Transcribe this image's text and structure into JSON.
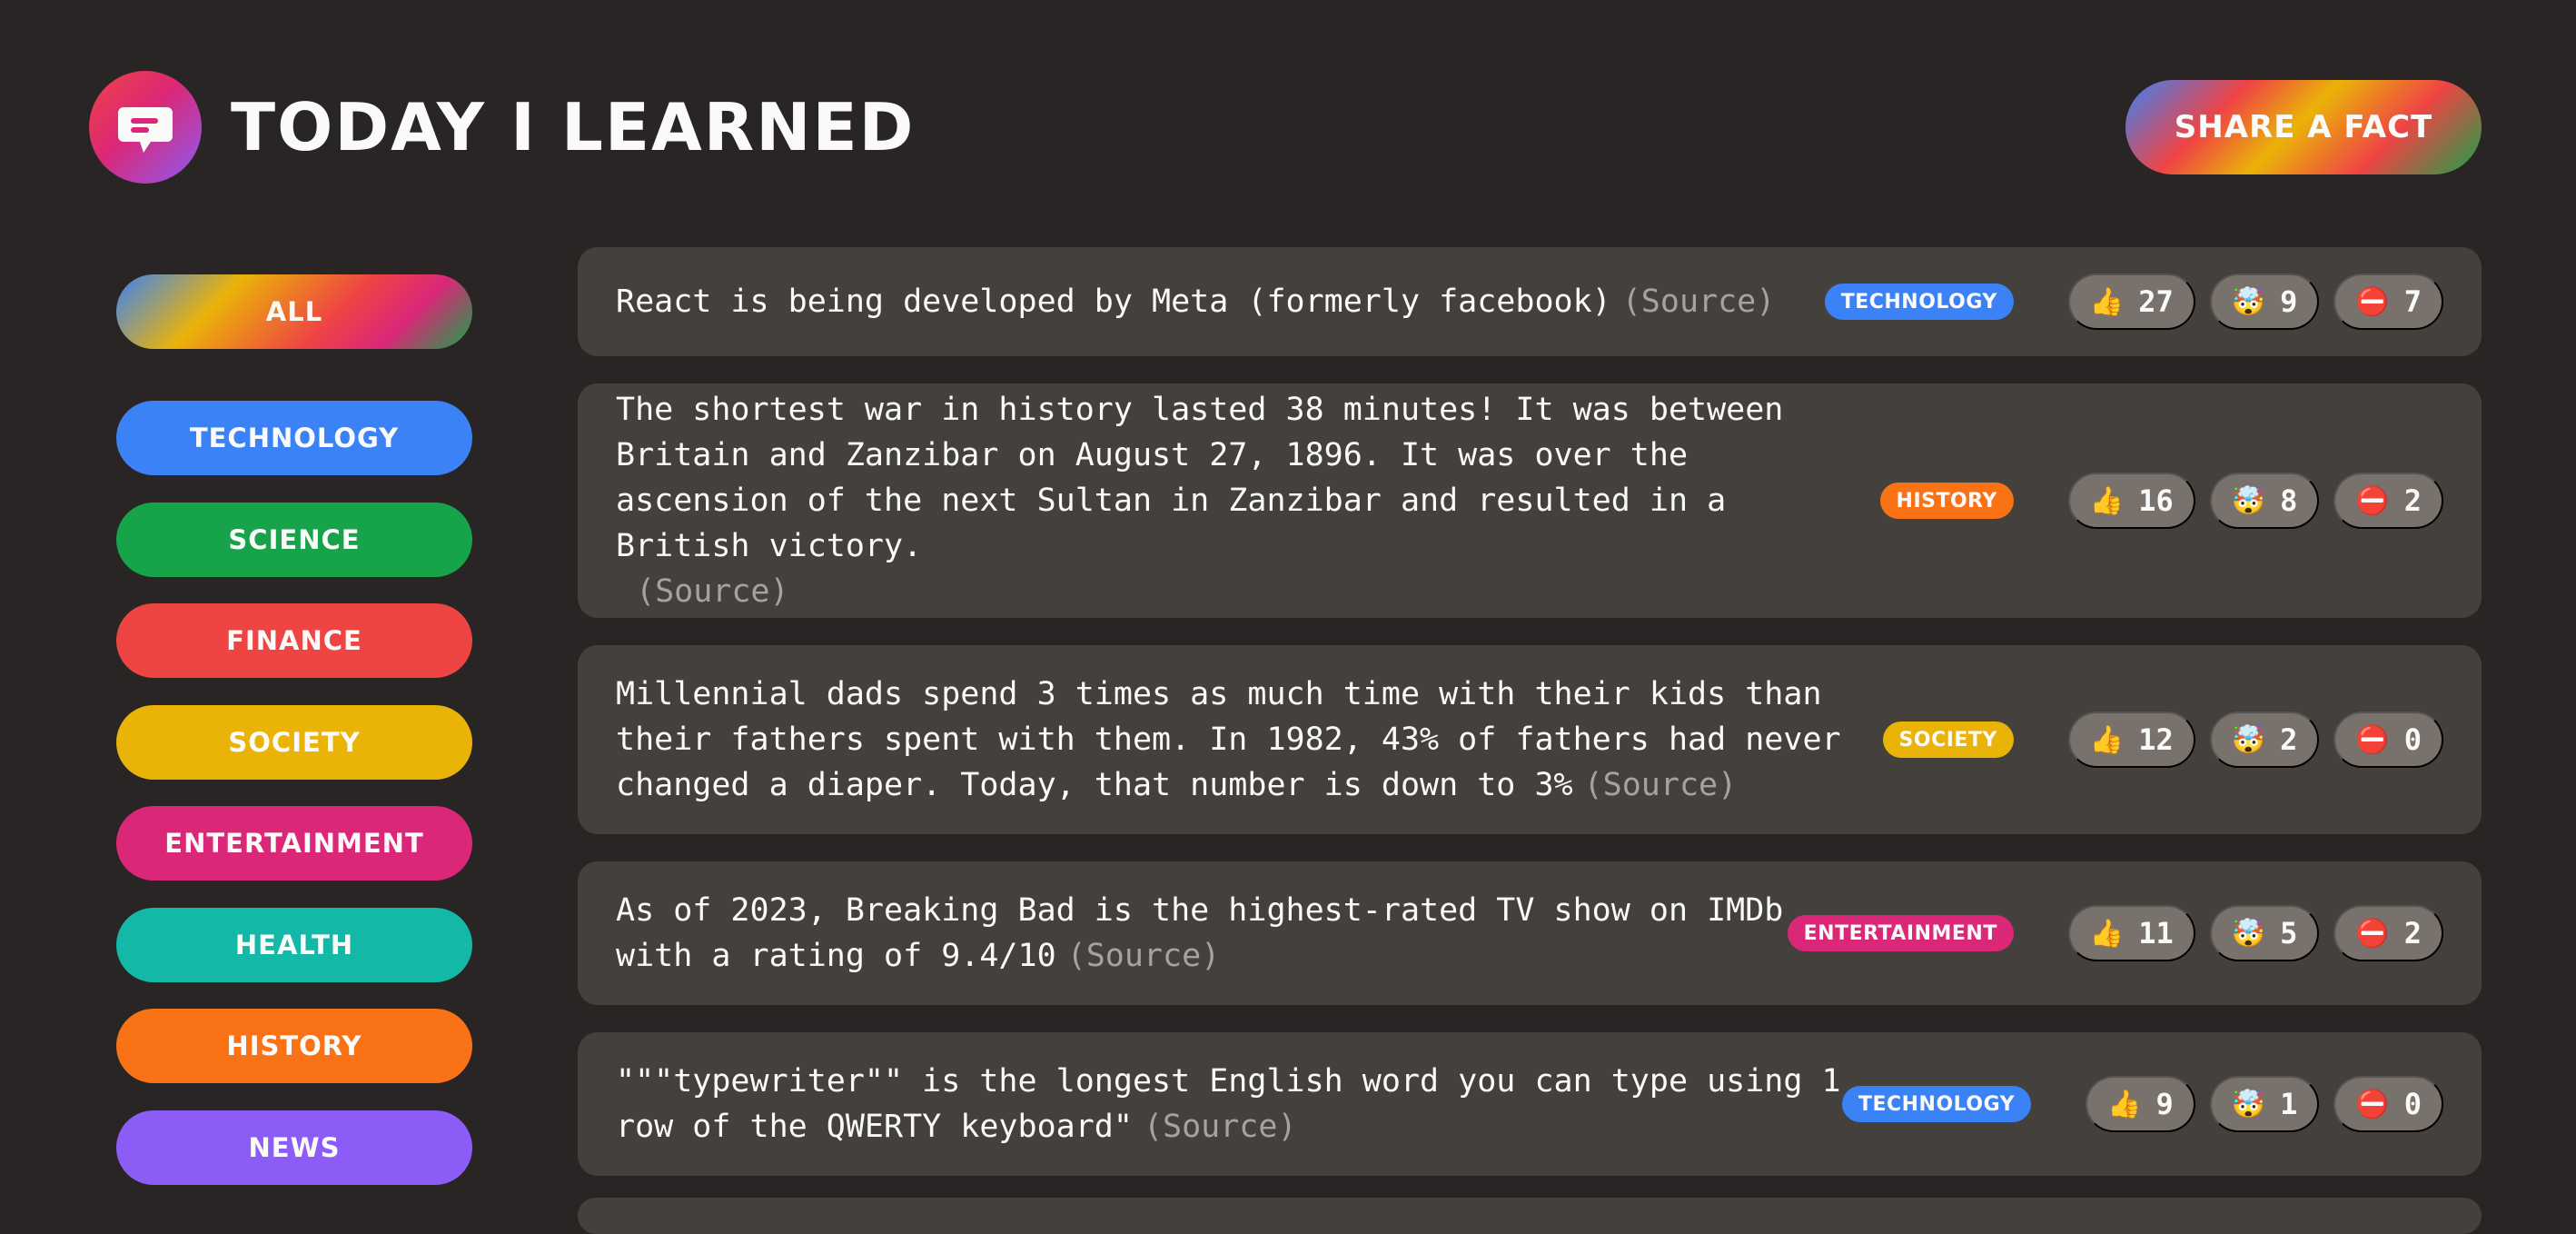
{
  "header": {
    "title": "Today I Learned",
    "share_label": "Share a fact",
    "logo_icon": "speech-bubble-icon"
  },
  "categories": [
    {
      "label": "All",
      "color": "gradient"
    },
    {
      "label": "technology",
      "color": "#3b82f6"
    },
    {
      "label": "science",
      "color": "#16a34a"
    },
    {
      "label": "finance",
      "color": "#ef4444"
    },
    {
      "label": "society",
      "color": "#eab308"
    },
    {
      "label": "entertainment",
      "color": "#db2777"
    },
    {
      "label": "health",
      "color": "#14b8a6"
    },
    {
      "label": "history",
      "color": "#f97316"
    },
    {
      "label": "news",
      "color": "#8b5cf6"
    }
  ],
  "facts": [
    {
      "text": "React is being developed by Meta (formerly facebook)",
      "source": "(Source)",
      "category": "technology",
      "category_color": "#3b82f6",
      "votes": {
        "interesting": "27",
        "mindblowing": "9",
        "false": "7"
      }
    },
    {
      "text": "The shortest war in history lasted 38 minutes! It was between Britain and Zanzibar on August 27, 1896. It was over the ascension of the next Sultan in Zanzibar and resulted in a British victory.",
      "source": "(Source)",
      "category": "history",
      "category_color": "#f97316",
      "votes": {
        "interesting": "16",
        "mindblowing": "8",
        "false": "2"
      }
    },
    {
      "text": "Millennial dads spend 3 times as much time with their kids than their fathers spent with them. In 1982, 43% of fathers had never changed a diaper. Today, that number is down to 3%",
      "source": "(Source)",
      "category": "society",
      "category_color": "#eab308",
      "votes": {
        "interesting": "12",
        "mindblowing": "2",
        "false": "0"
      }
    },
    {
      "text": "As of 2023, Breaking Bad is the highest-rated TV show on IMDb with a rating of 9.4/10",
      "source": "(Source)",
      "category": "entertainment",
      "category_color": "#db2777",
      "votes": {
        "interesting": "11",
        "mindblowing": "5",
        "false": "2"
      }
    },
    {
      "text": "\"\"\"typewriter\"\" is the longest English word you can type using 1 row of the QWERTY keyboard\"",
      "source": "(Source)",
      "category": "technology",
      "category_color": "#3b82f6",
      "votes": {
        "interesting": "9",
        "mindblowing": "1",
        "false": "0"
      }
    }
  ],
  "vote_icons": {
    "interesting": "👍",
    "mindblowing": "🤯",
    "false": "⛔️"
  }
}
